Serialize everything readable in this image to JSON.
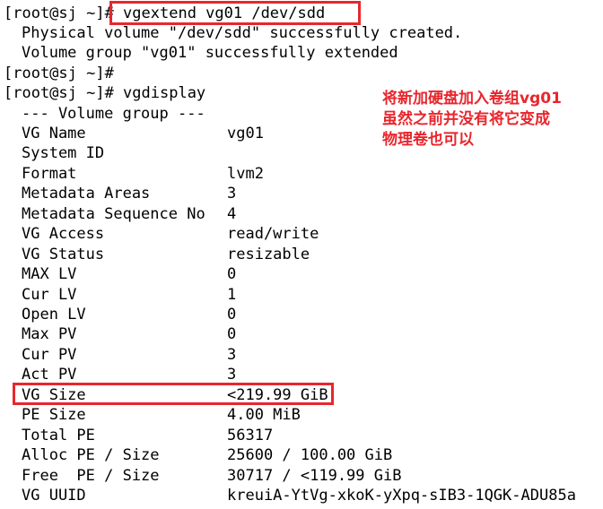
{
  "terminal": {
    "lines": {
      "l0": "[root@sj ~]# vgextend vg01 /dev/sdd",
      "l1": "Physical volume \"/dev/sdd\" successfully created.",
      "l2": "Volume group \"vg01\" successfully extended",
      "l3": "[root@sj ~]#",
      "l4": "[root@sj ~]# vgdisplay",
      "l5": "--- Volume group ---"
    },
    "fields": [
      {
        "key": "VG Name",
        "value": "vg01"
      },
      {
        "key": "System ID",
        "value": ""
      },
      {
        "key": "Format",
        "value": "lvm2"
      },
      {
        "key": "Metadata Areas",
        "value": "3"
      },
      {
        "key": "Metadata Sequence No",
        "value": "4"
      },
      {
        "key": "VG Access",
        "value": "read/write"
      },
      {
        "key": "VG Status",
        "value": "resizable"
      },
      {
        "key": "MAX LV",
        "value": "0"
      },
      {
        "key": "Cur LV",
        "value": "1"
      },
      {
        "key": "Open LV",
        "value": "0"
      },
      {
        "key": "Max PV",
        "value": "0"
      },
      {
        "key": "Cur PV",
        "value": "3"
      },
      {
        "key": "Act PV",
        "value": "3"
      },
      {
        "key": "VG Size",
        "value": "<219.99 GiB"
      },
      {
        "key": "PE Size",
        "value": "4.00 MiB"
      },
      {
        "key": "Total PE",
        "value": "56317"
      },
      {
        "key": "Alloc PE / Size",
        "value": "25600 / 100.00 GiB"
      },
      {
        "key": "Free  PE / Size",
        "value": "30717 / <119.99 GiB"
      },
      {
        "key": "VG UUID",
        "value": "kreuiA-YtVg-xkoK-yXpq-sIB3-1QGK-ADU85a"
      }
    ]
  },
  "annotation": {
    "text": "将新加硬盘加入卷组vg01\n虽然之前并没有将它变成\n物理卷也可以"
  },
  "colors": {
    "highlight": "#e8262d",
    "text": "#000000",
    "background": "#ffffff"
  }
}
